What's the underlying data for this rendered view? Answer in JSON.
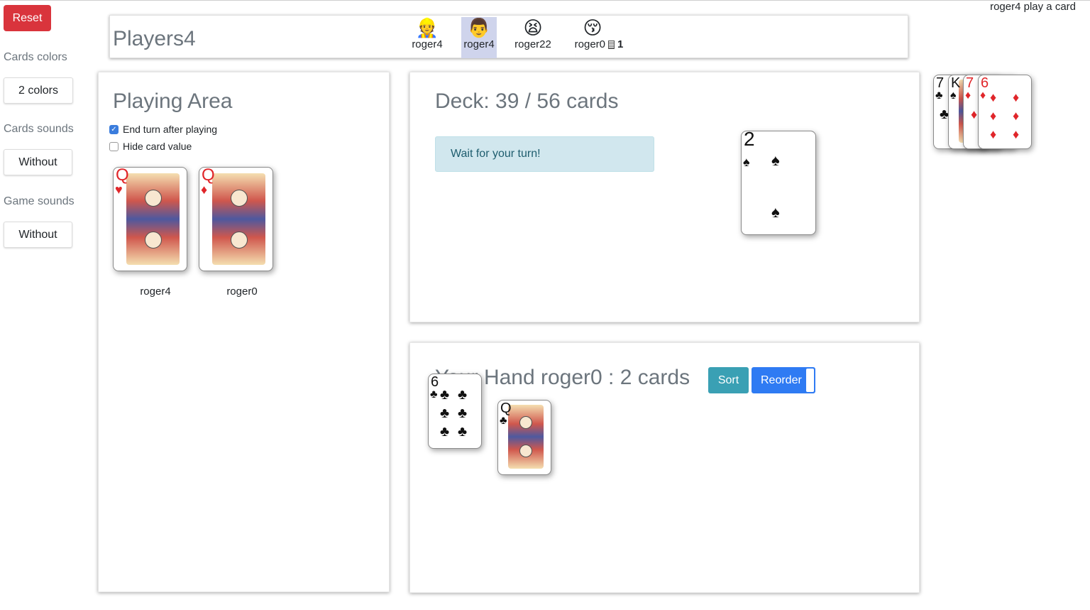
{
  "status_text": "roger4 play a card",
  "sidebar": {
    "reset_label": "Reset",
    "cards_colors_label": "Cards colors",
    "cards_colors_value": "2 colors",
    "cards_sounds_label": "Cards sounds",
    "cards_sounds_value": "Without",
    "game_sounds_label": "Game sounds",
    "game_sounds_value": "Without"
  },
  "players_bar": {
    "title": "Players4",
    "players": [
      {
        "emoji": "👷",
        "name": "roger4",
        "active": false
      },
      {
        "emoji": "👨",
        "name": "roger4",
        "active": true
      },
      {
        "emoji": "😫",
        "name": "roger22",
        "active": false
      },
      {
        "emoji": "😚",
        "name": "roger0",
        "active": false,
        "card_icon": "card-count-icon",
        "count": "1"
      }
    ]
  },
  "playing_area": {
    "title": "Playing Area",
    "end_turn_label": "End turn after playing",
    "end_turn_checked": true,
    "hide_value_label": "Hide card value",
    "hide_value_checked": false,
    "played_cards": [
      {
        "rank": "Q",
        "suit": "♥",
        "color": "red",
        "owner": "roger4"
      },
      {
        "rank": "Q",
        "suit": "♦",
        "color": "red",
        "owner": "roger0"
      }
    ]
  },
  "deck": {
    "title": "Deck: 39 / 56 cards",
    "alert": "Wait for your turn!",
    "top_card": {
      "rank": "2",
      "suit": "♠",
      "color": "black"
    }
  },
  "pile": [
    {
      "rank": "7",
      "suit": "♣",
      "color": "black"
    },
    {
      "rank": "K",
      "suit": "♠",
      "color": "black"
    },
    {
      "rank": "7",
      "suit": "♦",
      "color": "red"
    },
    {
      "rank": "6",
      "suit": "♦",
      "color": "red"
    }
  ],
  "hand": {
    "title": "Your Hand roger0 : 2 cards",
    "sort_label": "Sort",
    "reorder_label": "Reorder",
    "cards": [
      {
        "rank": "6",
        "suit": "♣",
        "color": "black"
      },
      {
        "rank": "Q",
        "suit": "♣",
        "color": "black"
      }
    ]
  }
}
